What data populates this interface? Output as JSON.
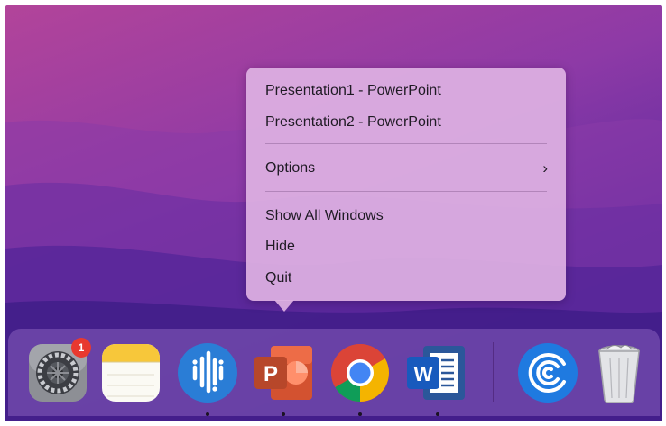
{
  "context_menu": {
    "windows": [
      "Presentation1 - PowerPoint",
      "Presentation2 - PowerPoint"
    ],
    "options_label": "Options",
    "options_chevron": "›",
    "show_all_windows": "Show All Windows",
    "hide": "Hide",
    "quit": "Quit"
  },
  "dock": {
    "apps": [
      {
        "name": "System Preferences",
        "icon": "system-preferences-icon",
        "running": false
      },
      {
        "name": "Notes",
        "icon": "notes-icon",
        "running": false
      },
      {
        "name": "Otter",
        "icon": "otter-icon",
        "running": true
      },
      {
        "name": "PowerPoint",
        "icon": "powerpoint-icon",
        "running": true
      },
      {
        "name": "Chrome",
        "icon": "chrome-icon",
        "running": true
      },
      {
        "name": "Word",
        "icon": "word-icon",
        "running": true
      },
      {
        "name": "Webex",
        "icon": "webex-icon",
        "running": false
      },
      {
        "name": "Trash",
        "icon": "trash-icon",
        "running": false
      }
    ],
    "system_preferences_badge": "1",
    "powerpoint_letter": "P",
    "word_letter": "W"
  },
  "colors": {
    "wallpaper_top": "#b2449a",
    "wallpaper_bottom": "#3a1d86",
    "menu_background": "#deb0e2",
    "badge_red": "#e8392f",
    "powerpoint_red": "#c43e1c",
    "word_blue": "#2b579a"
  }
}
